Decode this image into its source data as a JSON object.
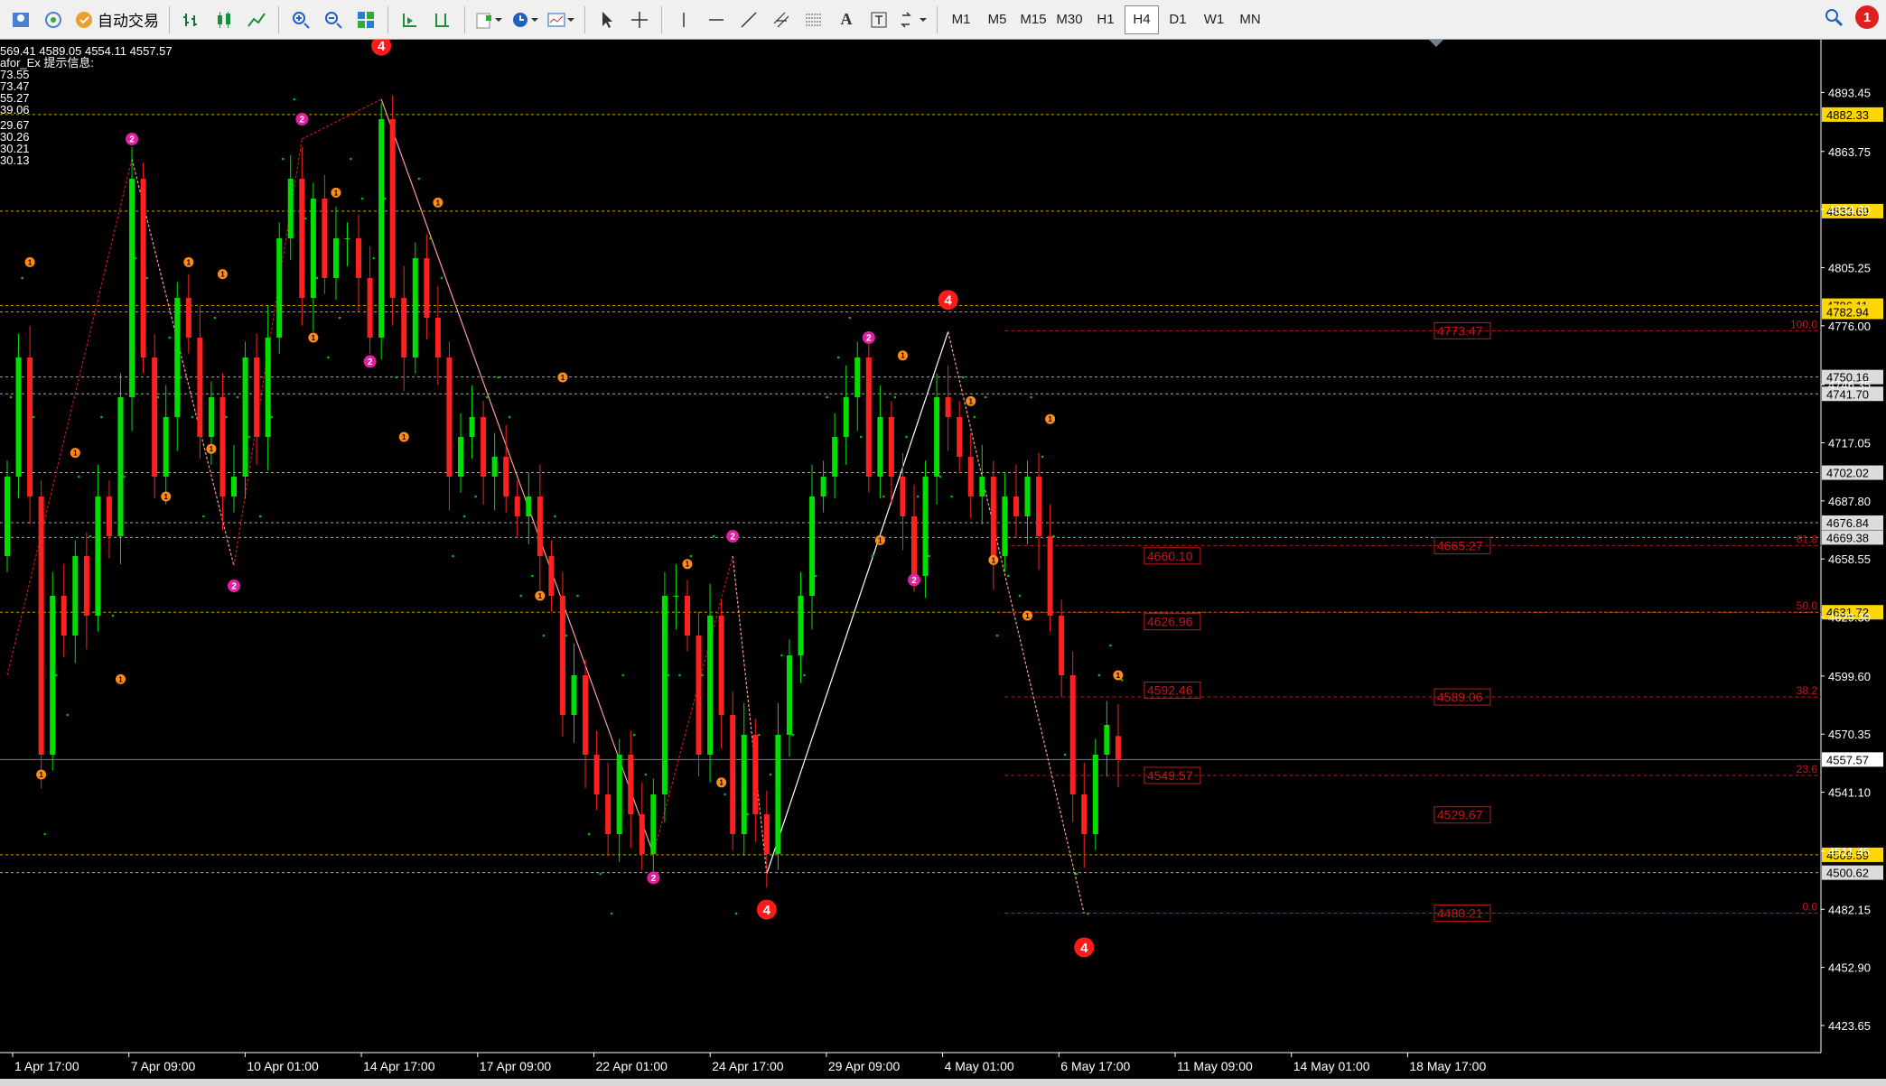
{
  "toolbar": {
    "auto_trade_label": "自动交易",
    "timeframes": [
      "M1",
      "M5",
      "M15",
      "M30",
      "H1",
      "H4",
      "D1",
      "W1",
      "MN"
    ],
    "active_timeframe": "H4",
    "notification_count": "1",
    "text_tool": "A"
  },
  "header": {
    "ohlc_line": "569.41 4589.05 4554.11 4557.57",
    "indicator_line": "afor_Ex 提示信息:",
    "values": [
      "73.55",
      "73.47",
      "55.27",
      "39.06",
      "29.67",
      "30.26",
      "30.21",
      "30.13"
    ]
  },
  "colors": {
    "bull": "#00e000",
    "bear": "#ff2020",
    "background": "#000000",
    "grid_text": "#ffffff"
  },
  "chart_data": {
    "type": "candlestick",
    "symbol_note": "",
    "y_range": [
      4410,
      4920
    ],
    "current_price": 4557.57,
    "y_ticks": [
      4893.45,
      4863.75,
      4834.6,
      4805.25,
      4776.0,
      4746.35,
      4717.05,
      4687.8,
      4658.55,
      4629.3,
      4599.6,
      4570.35,
      4541.1,
      4511.45,
      4482.15,
      4452.9,
      4423.65
    ],
    "y_tick_labels": [
      "4893.45",
      "4863.75",
      "4834.60",
      "4805.25",
      "4776.00",
      "4746.35",
      "4717.05",
      "4687.80",
      "4658.55",
      "4629.30",
      "4599.60",
      "4570.35",
      "4541.10",
      "4511.45",
      "4482.15",
      "4452.90",
      "4423.65"
    ],
    "x_labels": [
      "1 Apr 17:00",
      "7 Apr 09:00",
      "10 Apr 01:00",
      "14 Apr 17:00",
      "17 Apr 09:00",
      "22 Apr 01:00",
      "24 Apr 17:00",
      "29 Apr 09:00",
      "4 May 01:00",
      "6 May 17:00",
      "11 May 09:00",
      "14 May 01:00",
      "18 May 17:00"
    ],
    "horizontal_levels": [
      {
        "price": 4882.33,
        "label": "4882.33",
        "color": "#c8a000"
      },
      {
        "price": 4833.69,
        "label": "4833.69",
        "color": "#c8a000"
      },
      {
        "price": 4786.11,
        "label": "4786.11",
        "color": "#c8a000"
      },
      {
        "price": 4782.94,
        "label": "4782.94",
        "color": "#c8a000"
      },
      {
        "price": 4750.16,
        "label": "4750.16",
        "color": "#aaaaaa"
      },
      {
        "price": 4741.7,
        "label": "4741.70",
        "color": "#aaaaaa"
      },
      {
        "price": 4702.02,
        "label": "4702.02",
        "color": "#aaaaaa"
      },
      {
        "price": 4676.84,
        "label": "4676.84",
        "color": "#aaaaaa"
      },
      {
        "price": 4669.38,
        "label": "4669.38",
        "color": "#aaaaaa"
      },
      {
        "price": 4631.72,
        "label": "4631.72",
        "color": "#c8a000"
      },
      {
        "price": 4509.59,
        "label": "4509.59",
        "color": "#c8a000"
      },
      {
        "price": 4500.62,
        "label": "4500.62",
        "color": "#aaaaaa"
      }
    ],
    "fibo_levels": [
      {
        "pct": "100.0",
        "price": 4773.47
      },
      {
        "pct": "61.8",
        "price": 4665.27
      },
      {
        "pct": "50.0",
        "price": 4631.72
      },
      {
        "pct": "38.2",
        "price": 4589.06
      },
      {
        "pct": "23.6",
        "price": 4549.57
      },
      {
        "pct": "0.0",
        "price": 4480.21
      }
    ],
    "price_boxes": [
      {
        "text": "4773.47",
        "bar": 98,
        "price": 4773.47
      },
      {
        "text": "4665.27",
        "bar": 98,
        "price": 4665.27
      },
      {
        "text": "4589.06",
        "bar": 98,
        "price": 4589.06
      },
      {
        "text": "4529.67",
        "bar": 98,
        "price": 4529.67
      },
      {
        "text": "4480.21",
        "bar": 98,
        "price": 4480.21
      },
      {
        "text": "4660.10",
        "bar": 78,
        "price": 4660.1
      },
      {
        "text": "4626.96",
        "bar": 78,
        "price": 4626.96
      },
      {
        "text": "4592.46",
        "bar": 78,
        "price": 4592.46
      },
      {
        "text": "4549.57",
        "bar": 78,
        "price": 4549.57
      }
    ],
    "zigzag": [
      {
        "bar": 0,
        "price": 4600
      },
      {
        "bar": 11,
        "price": 4860
      },
      {
        "bar": 20,
        "price": 4655
      },
      {
        "bar": 26,
        "price": 4870
      },
      {
        "bar": 33,
        "price": 4890
      },
      {
        "bar": 57,
        "price": 4510
      },
      {
        "bar": 64,
        "price": 4660
      },
      {
        "bar": 67,
        "price": 4500
      },
      {
        "bar": 83,
        "price": 4773
      },
      {
        "bar": 95,
        "price": 4480
      }
    ],
    "pivot_markers": [
      {
        "bar": 33,
        "price": 4917,
        "label": "4",
        "color": "#ff1a1a",
        "size": "big"
      },
      {
        "bar": 67,
        "price": 4482,
        "label": "4",
        "color": "#ff1a1a",
        "size": "big"
      },
      {
        "bar": 83,
        "price": 4789,
        "label": "4",
        "color": "#ff1a1a",
        "size": "big"
      },
      {
        "bar": 95,
        "price": 4463,
        "label": "4",
        "color": "#ff1a1a",
        "size": "big"
      },
      {
        "bar": 11,
        "price": 4870,
        "label": "2",
        "color": "#e020a0",
        "size": "mid"
      },
      {
        "bar": 26,
        "price": 4880,
        "label": "2",
        "color": "#e020a0",
        "size": "mid"
      },
      {
        "bar": 20,
        "price": 4645,
        "label": "2",
        "color": "#e020a0",
        "size": "mid"
      },
      {
        "bar": 32,
        "price": 4758,
        "label": "2",
        "color": "#e020a0",
        "size": "mid"
      },
      {
        "bar": 57,
        "price": 4498,
        "label": "2",
        "color": "#e020a0",
        "size": "mid"
      },
      {
        "bar": 64,
        "price": 4670,
        "label": "2",
        "color": "#e020a0",
        "size": "mid"
      },
      {
        "bar": 76,
        "price": 4770,
        "label": "2",
        "color": "#e020a0",
        "size": "mid"
      },
      {
        "bar": 80,
        "price": 4648,
        "label": "2",
        "color": "#e020a0",
        "size": "mid"
      },
      {
        "bar": 2,
        "price": 4808,
        "label": "1",
        "color": "#ff8c1a",
        "size": "small"
      },
      {
        "bar": 3,
        "price": 4550,
        "label": "1",
        "color": "#ff8c1a",
        "size": "small"
      },
      {
        "bar": 6,
        "price": 4712,
        "label": "1",
        "color": "#ff8c1a",
        "size": "small"
      },
      {
        "bar": 10,
        "price": 4598,
        "label": "1",
        "color": "#ff8c1a",
        "size": "small"
      },
      {
        "bar": 14,
        "price": 4690,
        "label": "1",
        "color": "#ff8c1a",
        "size": "small"
      },
      {
        "bar": 16,
        "price": 4808,
        "label": "1",
        "color": "#ff8c1a",
        "size": "small"
      },
      {
        "bar": 18,
        "price": 4714,
        "label": "1",
        "color": "#ff8c1a",
        "size": "small"
      },
      {
        "bar": 19,
        "price": 4802,
        "label": "1",
        "color": "#ff8c1a",
        "size": "small"
      },
      {
        "bar": 27,
        "price": 4770,
        "label": "1",
        "color": "#ff8c1a",
        "size": "small"
      },
      {
        "bar": 29,
        "price": 4843,
        "label": "1",
        "color": "#ff8c1a",
        "size": "small"
      },
      {
        "bar": 35,
        "price": 4720,
        "label": "1",
        "color": "#ff8c1a",
        "size": "small"
      },
      {
        "bar": 38,
        "price": 4838,
        "label": "1",
        "color": "#ff8c1a",
        "size": "small"
      },
      {
        "bar": 49,
        "price": 4750,
        "label": "1",
        "color": "#ff8c1a",
        "size": "small"
      },
      {
        "bar": 47,
        "price": 4640,
        "label": "1",
        "color": "#ff8c1a",
        "size": "small"
      },
      {
        "bar": 60,
        "price": 4656,
        "label": "1",
        "color": "#ff8c1a",
        "size": "small"
      },
      {
        "bar": 63,
        "price": 4546,
        "label": "1",
        "color": "#ff8c1a",
        "size": "small"
      },
      {
        "bar": 77,
        "price": 4668,
        "label": "1",
        "color": "#ff8c1a",
        "size": "small"
      },
      {
        "bar": 79,
        "price": 4761,
        "label": "1",
        "color": "#ff8c1a",
        "size": "small"
      },
      {
        "bar": 85,
        "price": 4738,
        "label": "1",
        "color": "#ff8c1a",
        "size": "small"
      },
      {
        "bar": 87,
        "price": 4658,
        "label": "1",
        "color": "#ff8c1a",
        "size": "small"
      },
      {
        "bar": 90,
        "price": 4630,
        "label": "1",
        "color": "#ff8c1a",
        "size": "small"
      },
      {
        "bar": 92,
        "price": 4729,
        "label": "1",
        "color": "#ff8c1a",
        "size": "small"
      },
      {
        "bar": 98,
        "price": 4600,
        "label": "1",
        "color": "#ff8c1a",
        "size": "small"
      }
    ],
    "candles_close": [
      4700,
      4760,
      4690,
      4560,
      4640,
      4620,
      4660,
      4630,
      4690,
      4670,
      4740,
      4850,
      4760,
      4700,
      4730,
      4790,
      4770,
      4720,
      4740,
      4690,
      4700,
      4760,
      4720,
      4770,
      4820,
      4850,
      4790,
      4840,
      4800,
      4820,
      4820,
      4800,
      4770,
      4880,
      4790,
      4760,
      4810,
      4780,
      4760,
      4700,
      4720,
      4730,
      4700,
      4710,
      4690,
      4680,
      4690,
      4660,
      4640,
      4580,
      4600,
      4560,
      4540,
      4520,
      4560,
      4530,
      4510,
      4540,
      4640,
      4640,
      4620,
      4560,
      4630,
      4580,
      4520,
      4570,
      4530,
      4510,
      4570,
      4610,
      4640,
      4690,
      4700,
      4720,
      4740,
      4760,
      4700,
      4730,
      4700,
      4680,
      4650,
      4700,
      4740,
      4730,
      4710,
      4690,
      4700,
      4660,
      4690,
      4680,
      4700,
      4670,
      4630,
      4600,
      4540,
      4520,
      4560,
      4575,
      4557.57
    ],
    "candles_open": [
      4660,
      4700,
      4760,
      4690,
      4560,
      4640,
      4620,
      4660,
      4630,
      4690,
      4670,
      4740,
      4850,
      4760,
      4700,
      4730,
      4790,
      4770,
      4720,
      4740,
      4690,
      4700,
      4760,
      4720,
      4770,
      4820,
      4850,
      4790,
      4840,
      4800,
      4820,
      4820,
      4800,
      4770,
      4880,
      4790,
      4760,
      4810,
      4780,
      4760,
      4700,
      4720,
      4730,
      4700,
      4710,
      4690,
      4680,
      4690,
      4660,
      4640,
      4580,
      4600,
      4560,
      4540,
      4520,
      4560,
      4530,
      4510,
      4540,
      4640,
      4640,
      4620,
      4560,
      4630,
      4580,
      4520,
      4570,
      4530,
      4510,
      4570,
      4610,
      4640,
      4690,
      4700,
      4720,
      4740,
      4760,
      4700,
      4730,
      4700,
      4680,
      4650,
      4700,
      4740,
      4730,
      4710,
      4690,
      4700,
      4660,
      4690,
      4680,
      4700,
      4670,
      4630,
      4600,
      4540,
      4520,
      4560,
      4569.41
    ]
  }
}
